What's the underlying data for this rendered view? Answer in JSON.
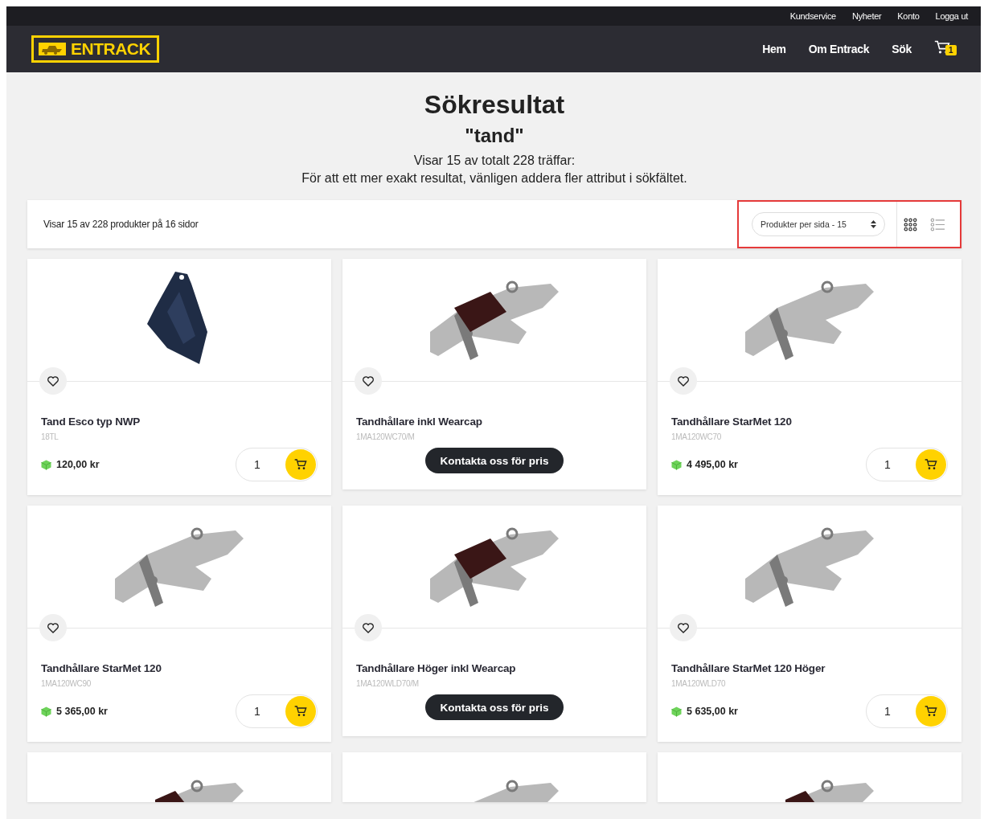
{
  "top_links": [
    "Kundservice",
    "Nyheter",
    "Konto",
    "Logga ut"
  ],
  "logo": {
    "text": "ENTRACK"
  },
  "nav": [
    "Hem",
    "Om Entrack",
    "Sök"
  ],
  "cart": {
    "count": "1"
  },
  "heading": {
    "title": "Sökresultat",
    "query": "\"tand\"",
    "summary": "Visar 15 av totalt 228 träffar:",
    "hint": "För att ett mer exakt resultat, vänligen addera fler attribut i sökfältet."
  },
  "toolbar": {
    "info": "Visar 15 av 228 produkter på 16 sidor",
    "per_page": "Produkter per sida - 15",
    "highlighted": true,
    "views": [
      {
        "kind": "grid",
        "selected": true
      },
      {
        "kind": "list",
        "selected": false
      }
    ]
  },
  "products": [
    {
      "kind": "buy",
      "image": {
        "kind": "tooth"
      },
      "name": "Tand Esco typ NWP",
      "sku": "18TL",
      "price": "120,00 kr",
      "qty": "1"
    },
    {
      "kind": "contact",
      "image": {
        "kind": "holder-cap"
      },
      "name": "Tandhållare inkl Wearcap",
      "sku": "1MA120WC70/M",
      "action": "Kontakta oss för pris"
    },
    {
      "kind": "buy",
      "image": {
        "kind": "holder"
      },
      "name": "Tandhållare StarMet 120",
      "sku": "1MA120WC70",
      "price": "4 495,00 kr",
      "qty": "1"
    },
    {
      "kind": "buy",
      "image": {
        "kind": "holder"
      },
      "name": "Tandhållare StarMet 120",
      "sku": "1MA120WC90",
      "price": "5 365,00 kr",
      "qty": "1"
    },
    {
      "kind": "contact",
      "image": {
        "kind": "holder-cap"
      },
      "name": "Tandhållare Höger inkl Wearcap",
      "sku": "1MA120WLD70/M",
      "action": "Kontakta oss för pris"
    },
    {
      "kind": "buy",
      "image": {
        "kind": "holder"
      },
      "name": "Tandhållare StarMet 120 Höger",
      "sku": "1MA120WLD70",
      "price": "5 635,00 kr",
      "qty": "1"
    },
    {
      "kind": "partial",
      "image": {
        "kind": "holder-cap"
      }
    },
    {
      "kind": "partial",
      "image": {
        "kind": "holder"
      }
    },
    {
      "kind": "partial",
      "image": {
        "kind": "holder-cap"
      }
    }
  ]
}
